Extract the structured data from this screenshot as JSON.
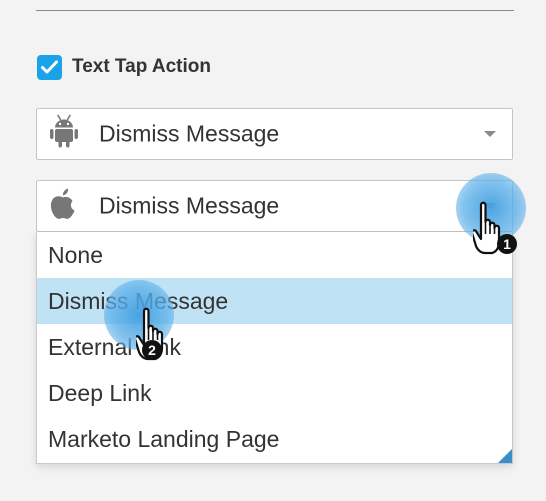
{
  "text_tap_action": {
    "checkbox_checked": true,
    "label": "Text Tap Action"
  },
  "android_select": {
    "icon": "android-icon",
    "value": "Dismiss Message"
  },
  "ios_select": {
    "icon": "apple-icon",
    "value": "Dismiss Message",
    "options": [
      "None",
      "Dismiss Message",
      "External Link",
      "Deep Link",
      "Marketo Landing Page"
    ],
    "selected_index": 1
  },
  "annotations": {
    "step1": "1",
    "step2": "2"
  },
  "colors": {
    "accent": "#1aa3e8",
    "highlight": "#bfe2f5",
    "click_indicator": "#42a0e2"
  }
}
